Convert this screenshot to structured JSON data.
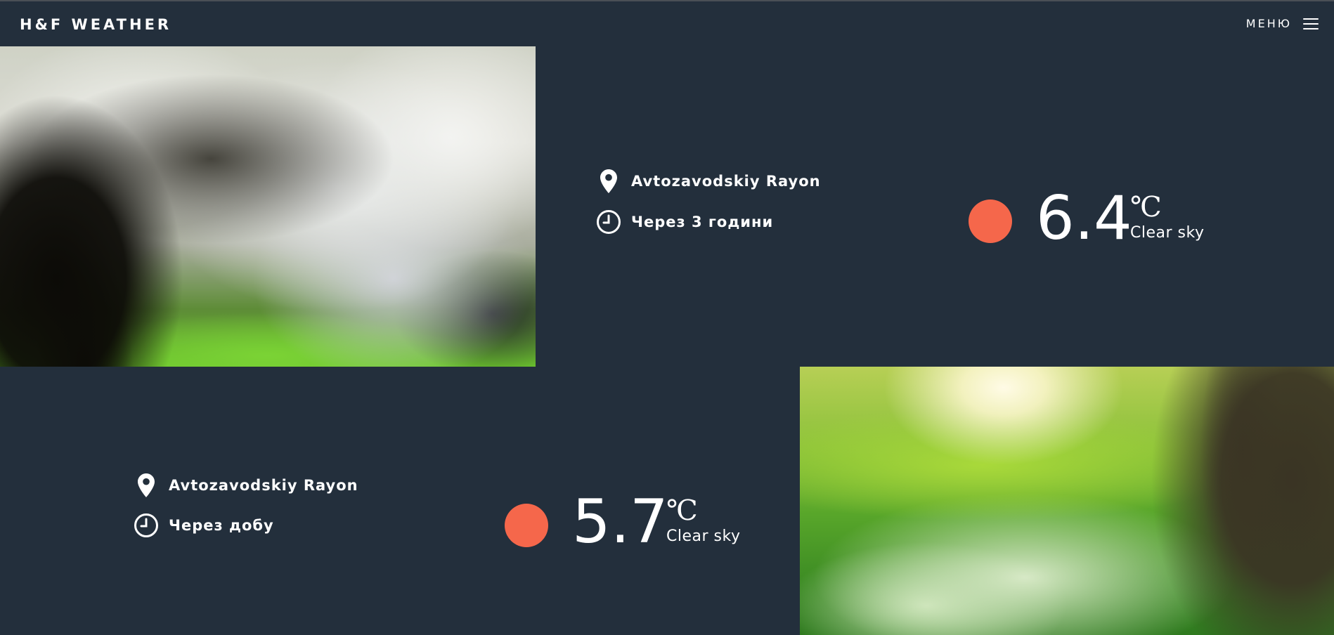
{
  "header": {
    "brand": "H&F WEATHER",
    "menu_label": "МЕНЮ"
  },
  "colors": {
    "background": "#232f3c",
    "sun_accent": "#f5674b",
    "text": "#ffffff"
  },
  "forecasts": [
    {
      "location": "Avtozavodskiy Rayon",
      "when": "Через 3 години",
      "temperature": "6.4",
      "unit": "℃",
      "condition": "Clear sky",
      "photo": "blossoming tree"
    },
    {
      "location": "Avtozavodskiy Rayon",
      "when": "Через добу",
      "temperature": "5.7",
      "unit": "℃",
      "condition": "Clear sky",
      "photo": "sunny meadow"
    }
  ],
  "icons": {
    "location": "map-pin-icon",
    "time": "clock-icon",
    "weather": "sun-icon",
    "menu": "hamburger-icon"
  }
}
